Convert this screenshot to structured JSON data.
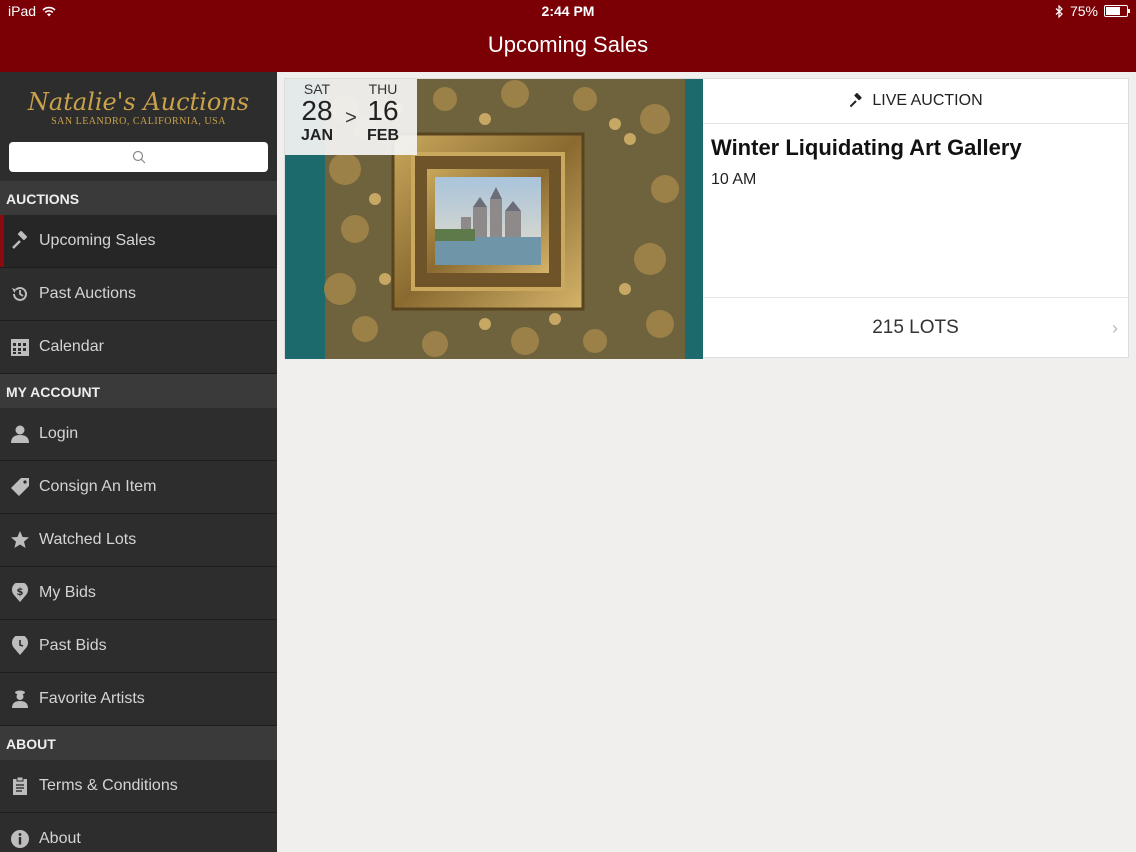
{
  "status_bar": {
    "device": "iPad",
    "time": "2:44 PM",
    "battery": "75%",
    "battery_level": 0.75
  },
  "nav": {
    "title": "Upcoming Sales"
  },
  "sidebar": {
    "brand": {
      "name": "Natalie's Auctions",
      "location": "SAN LEANDRO, CALIFORNIA, USA"
    },
    "sections": {
      "auctions": "AUCTIONS",
      "my_account": "MY ACCOUNT",
      "about": "ABOUT"
    },
    "items": {
      "upcoming_sales": "Upcoming Sales",
      "past_auctions": "Past Auctions",
      "calendar": "Calendar",
      "login": "Login",
      "consign": "Consign An Item",
      "watched": "Watched Lots",
      "my_bids": "My Bids",
      "past_bids": "Past Bids",
      "favorite_artists": "Favorite Artists",
      "terms": "Terms & Conditions",
      "about": "About"
    }
  },
  "sale": {
    "start": {
      "dow": "SAT",
      "day": "28",
      "month": "JAN"
    },
    "separator": ">",
    "end": {
      "dow": "THU",
      "day": "16",
      "month": "FEB"
    },
    "type": "LIVE AUCTION",
    "title": "Winter Liquidating Art Gallery",
    "time": "10 AM",
    "lots": "215 LOTS"
  }
}
